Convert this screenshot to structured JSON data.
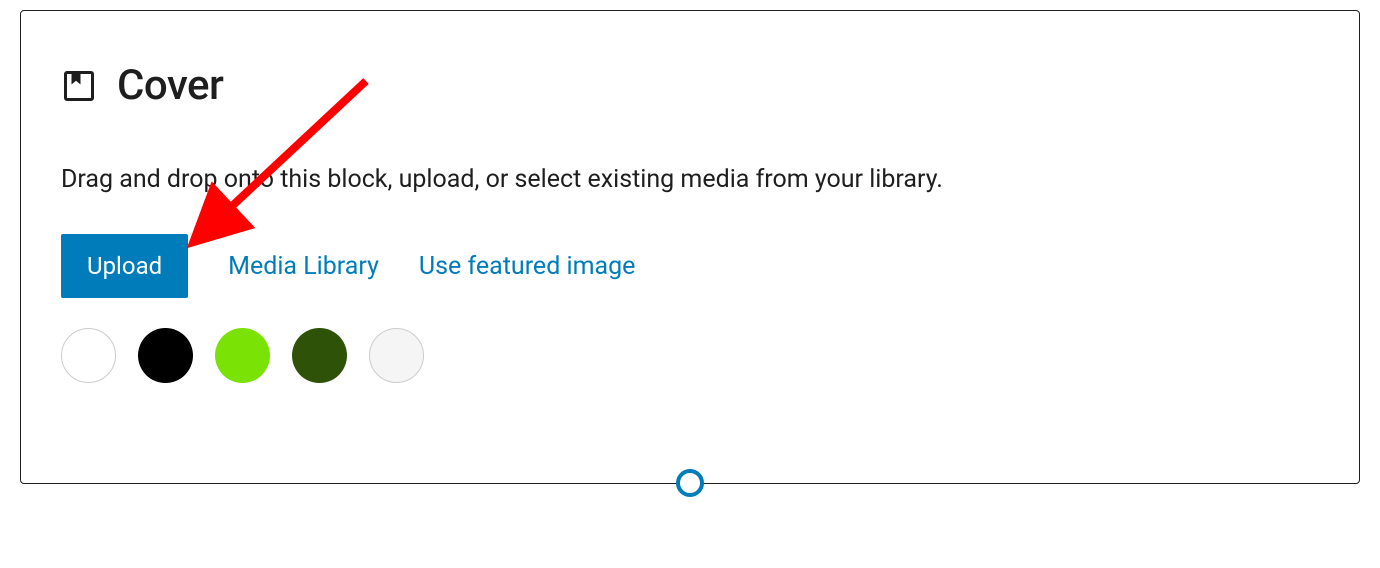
{
  "block": {
    "title": "Cover",
    "description": "Drag and drop onto this block, upload, or select existing media from your library."
  },
  "actions": {
    "upload_label": "Upload",
    "media_library_label": "Media Library",
    "featured_image_label": "Use featured image"
  },
  "color_swatches": [
    {
      "name": "white",
      "color": "#ffffff",
      "outlined": true
    },
    {
      "name": "black",
      "color": "#000000",
      "outlined": false
    },
    {
      "name": "lime-green",
      "color": "#7ae305",
      "outlined": false
    },
    {
      "name": "dark-green",
      "color": "#2e5208",
      "outlined": false
    },
    {
      "name": "light-gray",
      "color": "#f5f5f5",
      "outlined": true
    }
  ],
  "annotation": {
    "arrow_color": "#ff0000"
  }
}
